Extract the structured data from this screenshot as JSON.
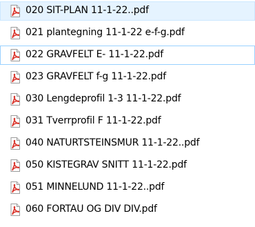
{
  "files": [
    {
      "name": "020 SIT-PLAN 11-1-22..pdf",
      "icon": "pdf-file-icon",
      "state": "hovered"
    },
    {
      "name": "021 plantegning 11-1-22 e-f-g.pdf",
      "icon": "pdf-file-icon",
      "state": ""
    },
    {
      "name": "022 GRAVFELT E- 11-1-22.pdf",
      "icon": "pdf-file-icon",
      "state": "focused"
    },
    {
      "name": "023 GRAVFELT  f-g  11-1-22.pdf",
      "icon": "pdf-file-icon",
      "state": ""
    },
    {
      "name": "030 Lengdeprofil 1-3  11-1-22.pdf",
      "icon": "pdf-file-icon",
      "state": ""
    },
    {
      "name": "031 Tverrprofil F  11-1-22.pdf",
      "icon": "pdf-file-icon",
      "state": ""
    },
    {
      "name": "040 NATURTSTEINSMUR  11-1-22..pdf",
      "icon": "pdf-file-icon",
      "state": ""
    },
    {
      "name": "050 KISTEGRAV SNITT  11-1-22.pdf",
      "icon": "pdf-file-icon",
      "state": ""
    },
    {
      "name": "051 MINNELUND  11-1-22..pdf",
      "icon": "pdf-file-icon",
      "state": ""
    },
    {
      "name": "060 FORTAU OG DIV DIV.pdf",
      "icon": "pdf-file-icon",
      "state": ""
    }
  ],
  "colors": {
    "hover_background": "#e5f3ff",
    "hover_border": "#cce8ff",
    "focus_border": "#99d1ff",
    "pdf_red": "#d9342b"
  }
}
